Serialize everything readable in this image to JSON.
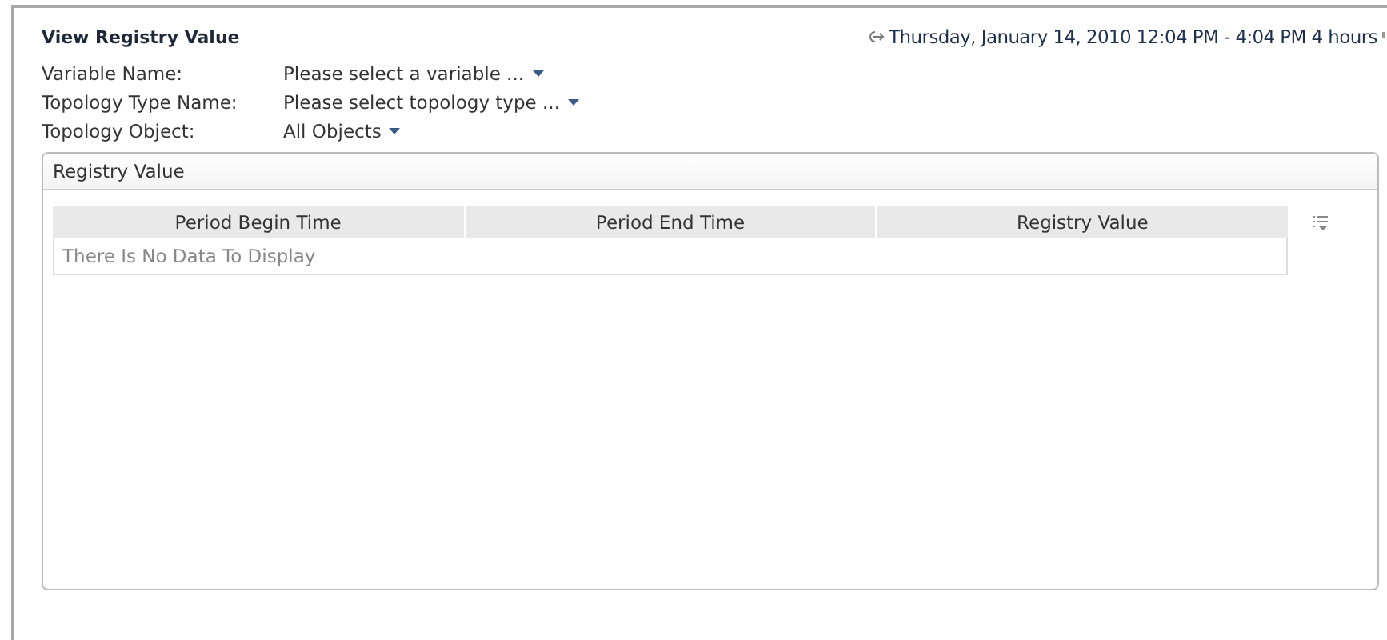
{
  "title": "View Registry Value",
  "time_range": "Thursday, January 14, 2010 12:04 PM - 4:04 PM 4 hours",
  "filters": [
    {
      "label": "Variable Name:",
      "value": "Please select a variable ..."
    },
    {
      "label": "Topology Type Name:",
      "value": "Please select topology type ..."
    },
    {
      "label": "Topology Object:",
      "value": "All Objects"
    }
  ],
  "panel": {
    "title": "Registry Value",
    "table": {
      "columns": [
        "Period Begin Time",
        "Period End Time",
        "Registry Value"
      ],
      "empty_message": "There Is No Data To Display"
    }
  }
}
